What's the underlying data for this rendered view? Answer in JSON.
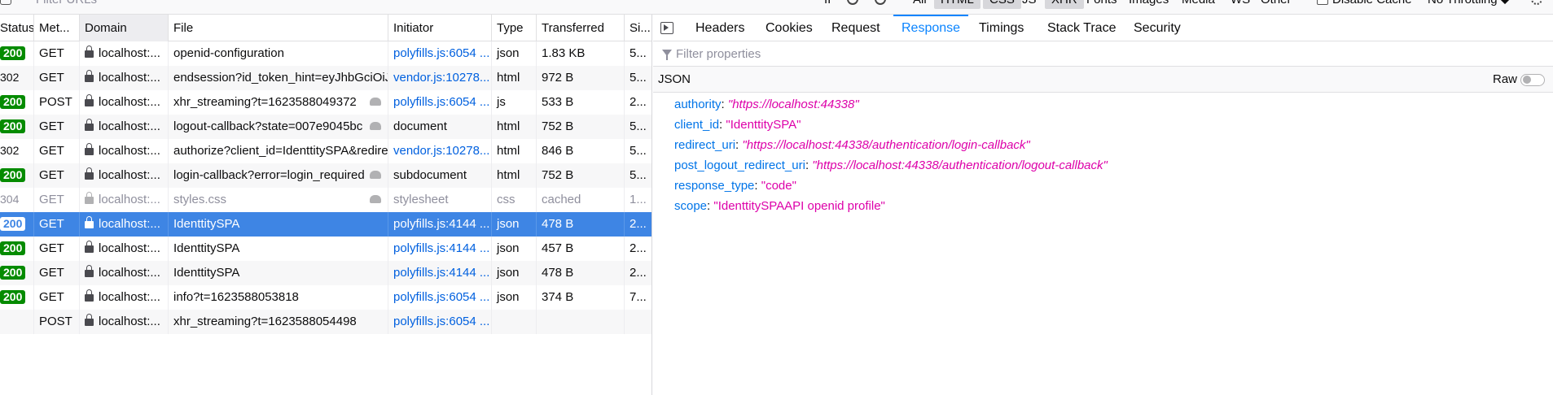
{
  "toolbar": {
    "filter_placeholder": "Filter URLs",
    "types": [
      {
        "label": "All",
        "active": false
      },
      {
        "label": "HTML",
        "active": true
      },
      {
        "label": "CSS",
        "active": true
      },
      {
        "label": "JS",
        "active": false
      },
      {
        "label": "XHR",
        "active": true
      },
      {
        "label": "Fonts",
        "active": false
      },
      {
        "label": "Images",
        "active": false
      },
      {
        "label": "Media",
        "active": false
      },
      {
        "label": "WS",
        "active": false
      },
      {
        "label": "Other",
        "active": false
      }
    ],
    "pause_label": "II",
    "disable_cache_label": "Disable Cache",
    "throttling_label": "No Throttling ⬥"
  },
  "table": {
    "columns": [
      "Status",
      "Met...",
      "Domain",
      "File",
      "Initiator",
      "Type",
      "Transferred",
      "Si..."
    ],
    "rows": [
      {
        "status": "200",
        "status_kind": "ok",
        "method": "GET",
        "domain": "localhost:...",
        "file": "openid-configuration",
        "initiator": "polyfills.js:6054 ...",
        "type": "json",
        "transferred": "1.83 KB",
        "size": "5...",
        "tracker": false,
        "selected": false,
        "dim": false
      },
      {
        "status": "302",
        "status_kind": "redirect",
        "method": "GET",
        "domain": "localhost:...",
        "file": "endsession?id_token_hint=eyJhbGciOiJS",
        "initiator": "vendor.js:10278...",
        "type": "html",
        "transferred": "972 B",
        "size": "5...",
        "tracker": false,
        "selected": false,
        "dim": false
      },
      {
        "status": "200",
        "status_kind": "ok",
        "method": "POST",
        "domain": "localhost:...",
        "file": "xhr_streaming?t=1623588049372",
        "initiator": "polyfills.js:6054 ...",
        "type": "js",
        "transferred": "533 B",
        "size": "2...",
        "tracker": true,
        "selected": false,
        "dim": false
      },
      {
        "status": "200",
        "status_kind": "ok",
        "method": "GET",
        "domain": "localhost:...",
        "file": "logout-callback?state=007e9045bc",
        "initiator": "document",
        "type": "html",
        "transferred": "752 B",
        "size": "5...",
        "tracker": true,
        "selected": false,
        "dim": false
      },
      {
        "status": "302",
        "status_kind": "redirect",
        "method": "GET",
        "domain": "localhost:...",
        "file": "authorize?client_id=IdenttitySPA&redire",
        "initiator": "vendor.js:10278...",
        "type": "html",
        "transferred": "846 B",
        "size": "5...",
        "tracker": false,
        "selected": false,
        "dim": false
      },
      {
        "status": "200",
        "status_kind": "ok",
        "method": "GET",
        "domain": "localhost:...",
        "file": "login-callback?error=login_required",
        "initiator": "subdocument",
        "type": "html",
        "transferred": "752 B",
        "size": "5...",
        "tracker": true,
        "selected": false,
        "dim": false
      },
      {
        "status": "304",
        "status_kind": "cached",
        "method": "GET",
        "domain": "localhost:...",
        "file": "styles.css",
        "initiator": "stylesheet",
        "type": "css",
        "transferred": "cached",
        "size": "1...",
        "tracker": true,
        "selected": false,
        "dim": true
      },
      {
        "status": "200",
        "status_kind": "ok",
        "method": "GET",
        "domain": "localhost:...",
        "file": "IdenttitySPA",
        "initiator": "polyfills.js:4144 ...",
        "type": "json",
        "transferred": "478 B",
        "size": "2...",
        "tracker": false,
        "selected": true,
        "dim": false
      },
      {
        "status": "200",
        "status_kind": "ok",
        "method": "GET",
        "domain": "localhost:...",
        "file": "IdenttitySPA",
        "initiator": "polyfills.js:4144 ...",
        "type": "json",
        "transferred": "457 B",
        "size": "2...",
        "tracker": false,
        "selected": false,
        "dim": false
      },
      {
        "status": "200",
        "status_kind": "ok",
        "method": "GET",
        "domain": "localhost:...",
        "file": "IdenttitySPA",
        "initiator": "polyfills.js:4144 ...",
        "type": "json",
        "transferred": "478 B",
        "size": "2...",
        "tracker": false,
        "selected": false,
        "dim": false
      },
      {
        "status": "200",
        "status_kind": "ok",
        "method": "GET",
        "domain": "localhost:...",
        "file": "info?t=1623588053818",
        "initiator": "polyfills.js:6054 ...",
        "type": "json",
        "transferred": "374 B",
        "size": "7...",
        "tracker": false,
        "selected": false,
        "dim": false
      },
      {
        "status": "",
        "status_kind": "none",
        "method": "POST",
        "domain": "localhost:...",
        "file": "xhr_streaming?t=1623588054498",
        "initiator": "polyfills.js:6054 ...",
        "type": "",
        "transferred": "",
        "size": "",
        "tracker": false,
        "selected": false,
        "dim": false
      }
    ]
  },
  "details": {
    "tabs": [
      "Headers",
      "Cookies",
      "Request",
      "Response",
      "Timings",
      "Stack Trace",
      "Security"
    ],
    "active_tab": "Response",
    "filter_placeholder": "Filter properties",
    "section_title": "JSON",
    "raw_label": "Raw",
    "raw_enabled": false,
    "json": [
      {
        "key": "authority",
        "value": "\"https://localhost:44338\"",
        "italic": true
      },
      {
        "key": "client_id",
        "value": "\"IdenttitySPA\"",
        "italic": false
      },
      {
        "key": "redirect_uri",
        "value": "\"https://localhost:44338/authentication/login-callback\"",
        "italic": true
      },
      {
        "key": "post_logout_redirect_uri",
        "value": "\"https://localhost:44338/authentication/logout-callback\"",
        "italic": true
      },
      {
        "key": "response_type",
        "value": "\"code\"",
        "italic": false
      },
      {
        "key": "scope",
        "value": "\"IdenttitySPAAPI openid profile\"",
        "italic": false
      }
    ]
  },
  "colors": {
    "accent": "#0a84ff",
    "selected_row": "#3e85e4",
    "status_ok": "#058b00",
    "json_key": "#0074e8",
    "json_string": "#dd00a9"
  }
}
